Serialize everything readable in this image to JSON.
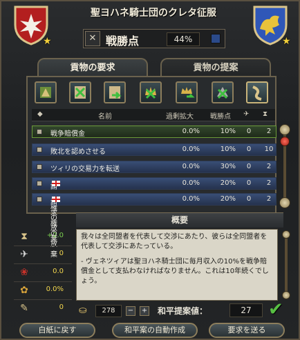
{
  "header": {
    "title": "聖ヨハネ騎士団のクレタ征服",
    "score_label": "戦勝点",
    "score_value": "44%"
  },
  "tabs": [
    {
      "label": "貢物の要求",
      "active": true
    },
    {
      "label": "貢物の提案",
      "active": false
    }
  ],
  "actions": [
    "take-provinces",
    "reduce-cancel",
    "transfer",
    "cancel-crown",
    "release-annex",
    "war-reparations-cancel",
    "humiliate"
  ],
  "table": {
    "headers": {
      "name": "名前",
      "expansion": "過剰拡大",
      "points": "戦勝点"
    },
    "rows": [
      {
        "name": "戦争賠償金",
        "expansion": "0.0%",
        "points": "10%",
        "c1": "0",
        "c2": "2",
        "flag": false,
        "selected": true
      },
      {
        "name": "敗北を認めさせる",
        "expansion": "0.0%",
        "points": "10%",
        "c1": "0",
        "c2": "10",
        "flag": false,
        "selected": false
      },
      {
        "name": "ツィリの交易力を転送",
        "expansion": "0.0%",
        "points": "30%",
        "c1": "0",
        "c2": "2",
        "flag": false,
        "selected": false
      },
      {
        "name": "請求権の放棄",
        "expansion": "0.0%",
        "points": "20%",
        "c1": "0",
        "c2": "2",
        "flag": true,
        "selected": false
      },
      {
        "name": "請求権の放棄",
        "expansion": "0.0%",
        "points": "20%",
        "c1": "0",
        "c2": "2",
        "flag": true,
        "selected": false
      }
    ]
  },
  "summary": {
    "title": "概要",
    "side_values": [
      "+2.0",
      "0",
      "0.0",
      "0.0%",
      "0"
    ],
    "para1": "我々は全同盟者を代表して交渉にあたり、彼らは全同盟者を代表して交渉にあたっている。",
    "para2": "- ヴェネツィアは聖ヨハネ騎士団に毎月収入の10%を戦争賠償金として支払わなければなりません。これは10年続くでしょう。"
  },
  "controls": {
    "amount": "278",
    "minus": "−",
    "plus": "+",
    "peace_label": "和平提案値：",
    "peace_value": "27"
  },
  "buttons": {
    "blank": "白紙に戻す",
    "auto": "和平案の自動作成",
    "send": "要求を送る"
  },
  "colors": {
    "selected_row": "#33472d",
    "row": "#394e76",
    "positive": "#7cd051",
    "value": "#f2d64e"
  }
}
